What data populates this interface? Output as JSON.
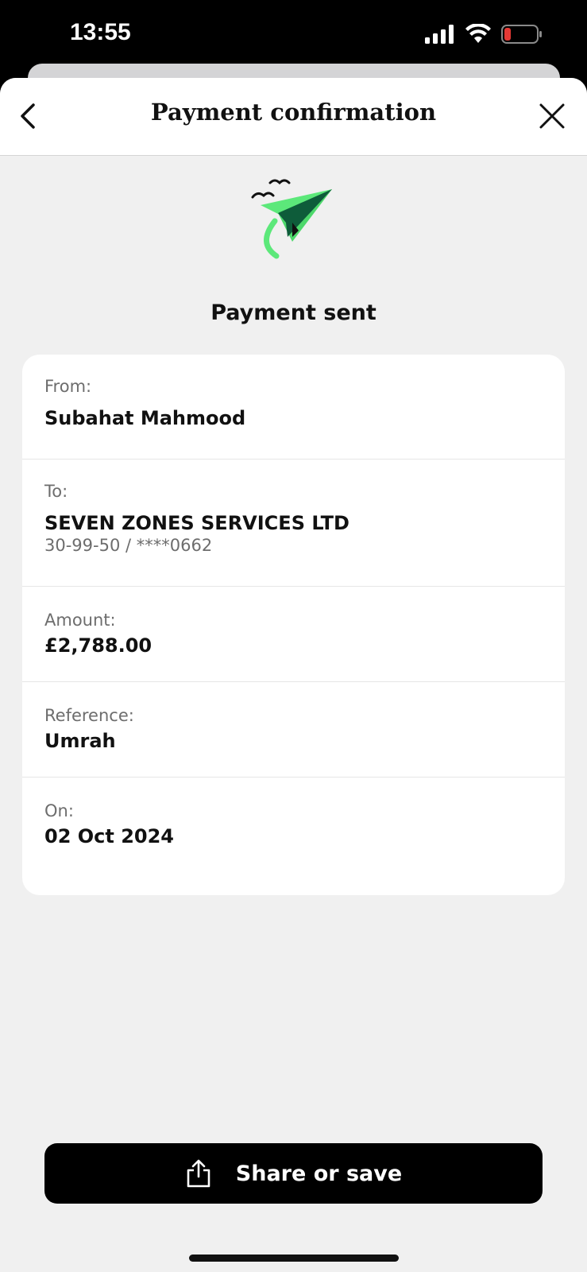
{
  "status_bar": {
    "time": "13:55"
  },
  "nav": {
    "title": "Payment confirmation"
  },
  "confirmation": {
    "heading": "Payment sent"
  },
  "details": {
    "from_label": "From:",
    "from_value": "Subahat Mahmood",
    "to_label": "To:",
    "to_value": "SEVEN ZONES SERVICES LTD",
    "to_account": "30-99-50 / ****0662",
    "amount_label": "Amount:",
    "amount_value": "£2,788.00",
    "reference_label": "Reference:",
    "reference_value": "Umrah",
    "on_label": "On:",
    "on_value": "02 Oct 2024"
  },
  "actions": {
    "share_label": "Share or save"
  },
  "colors": {
    "accent_green": "#5ce87a",
    "dark_green": "#0e5c3a",
    "button_bg": "#000000",
    "battery_red": "#e53935"
  }
}
